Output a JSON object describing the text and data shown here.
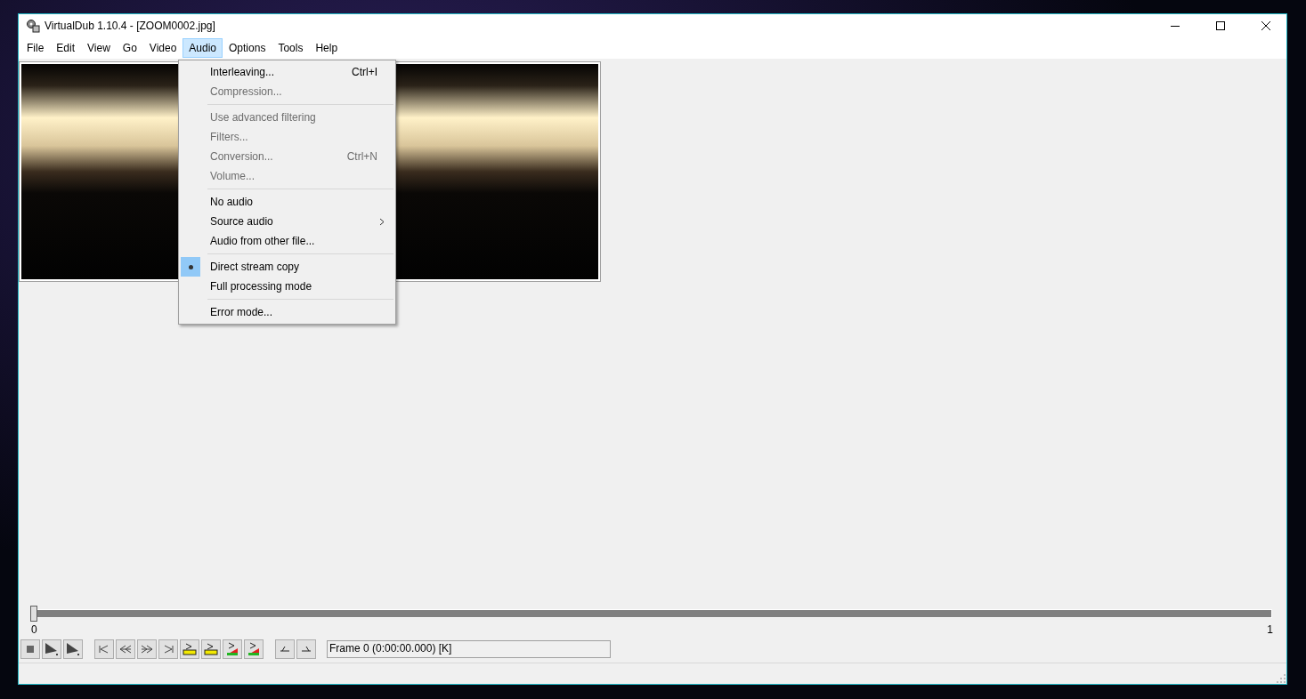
{
  "window": {
    "title": "VirtualDub 1.10.4 - [ZOOM0002.jpg]"
  },
  "menu_bar": [
    {
      "label": "File",
      "selected": false
    },
    {
      "label": "Edit",
      "selected": false
    },
    {
      "label": "View",
      "selected": false
    },
    {
      "label": "Go",
      "selected": false
    },
    {
      "label": "Video",
      "selected": false
    },
    {
      "label": "Audio",
      "selected": true
    },
    {
      "label": "Options",
      "selected": false
    },
    {
      "label": "Tools",
      "selected": false
    },
    {
      "label": "Help",
      "selected": false
    }
  ],
  "audio_menu": [
    {
      "kind": "item",
      "label": "Interleaving...",
      "shortcut": "Ctrl+I",
      "disabled": false,
      "checked": false
    },
    {
      "kind": "item",
      "label": "Compression...",
      "disabled": true,
      "checked": false
    },
    {
      "kind": "separator"
    },
    {
      "kind": "item",
      "label": "Use advanced filtering",
      "disabled": true,
      "checked": false
    },
    {
      "kind": "item",
      "label": "Filters...",
      "disabled": true,
      "checked": false
    },
    {
      "kind": "item",
      "label": "Conversion...",
      "shortcut": "Ctrl+N",
      "disabled": true,
      "checked": false
    },
    {
      "kind": "item",
      "label": "Volume...",
      "disabled": true,
      "checked": false
    },
    {
      "kind": "separator"
    },
    {
      "kind": "item",
      "label": "No audio",
      "disabled": false,
      "checked": false
    },
    {
      "kind": "submenu",
      "label": "Source audio",
      "disabled": false,
      "checked": false
    },
    {
      "kind": "item",
      "label": "Audio from other file...",
      "disabled": false,
      "checked": false
    },
    {
      "kind": "separator"
    },
    {
      "kind": "item",
      "label": "Direct stream copy",
      "disabled": false,
      "checked": true
    },
    {
      "kind": "item",
      "label": "Full processing mode",
      "disabled": false,
      "checked": false
    },
    {
      "kind": "separator"
    },
    {
      "kind": "item",
      "label": "Error mode...",
      "disabled": false,
      "checked": false
    }
  ],
  "timeline": {
    "level": 0,
    "start_label": "0",
    "end_label": "1"
  },
  "frame_status": "Frame 0 (0:00:00.000) [K]"
}
